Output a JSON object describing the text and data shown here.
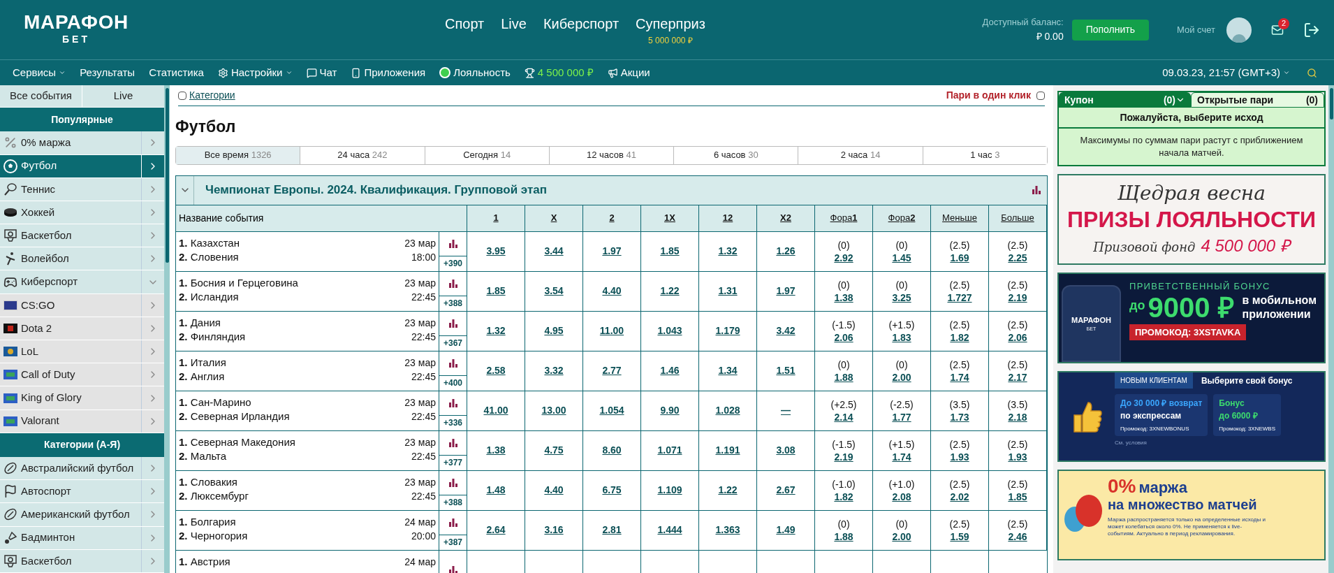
{
  "header": {
    "logo_top": "МАРАФОН",
    "logo_bottom": "БЕТ",
    "main_nav": [
      {
        "label": "Спорт"
      },
      {
        "label": "Live"
      },
      {
        "label": "Киберспорт"
      },
      {
        "label": "Суперприз",
        "sub": "5 000 000 ₽"
      }
    ],
    "balance_label": "Доступный баланс:",
    "balance": "₽ 0.00",
    "deposit_button": "Пополнить",
    "account": "Мой счет",
    "mail_badge": "2"
  },
  "nav": {
    "items": [
      {
        "label": "Сервисы",
        "kind": "menu"
      },
      {
        "label": "Результаты",
        "kind": "link"
      },
      {
        "label": "Статистика",
        "kind": "link"
      },
      {
        "label": "Настройки",
        "kind": "settings"
      },
      {
        "label": "Чат",
        "kind": "chat"
      },
      {
        "label": "Приложения",
        "kind": "app"
      },
      {
        "label": "Лояльность",
        "kind": "loyalty"
      },
      {
        "label": "4 500 000 ₽",
        "kind": "prize"
      },
      {
        "label": "Акции",
        "kind": "promo"
      }
    ],
    "datetime": "09.03.23, 21:57 (GMT+3)"
  },
  "sidebar": {
    "tabs": [
      {
        "label": "Все события"
      },
      {
        "label": "Live"
      }
    ],
    "sections": [
      {
        "title": "Популярные",
        "items": [
          {
            "label": "0% маржа",
            "kind": "margin",
            "selected": false,
            "expanded": false
          },
          {
            "label": "Футбол",
            "kind": "football",
            "selected": true,
            "expanded": false
          },
          {
            "label": "Теннис",
            "kind": "tennis",
            "selected": false,
            "expanded": false
          },
          {
            "label": "Хоккей",
            "kind": "hockey",
            "selected": false,
            "expanded": false
          },
          {
            "label": "Баскетбол",
            "kind": "basketball",
            "selected": false,
            "expanded": false
          },
          {
            "label": "Волейбол",
            "kind": "volleyball",
            "selected": false,
            "expanded": false
          },
          {
            "label": "Киберспорт",
            "kind": "esports",
            "selected": false,
            "expanded": true,
            "children": [
              {
                "label": "CS:GO",
                "kind": "csgo",
                "selected": false
              },
              {
                "label": "Dota 2",
                "kind": "dota",
                "selected": false
              },
              {
                "label": "LoL",
                "kind": "lol",
                "selected": false
              },
              {
                "label": "Call of Duty",
                "kind": "map",
                "selected": false
              },
              {
                "label": "King of Glory",
                "kind": "map",
                "selected": false
              },
              {
                "label": "Valorant",
                "kind": "map",
                "selected": false
              }
            ]
          }
        ]
      },
      {
        "title": "Категории (А-Я)",
        "items": [
          {
            "label": "Австралийский футбол",
            "kind": "oval",
            "selected": false,
            "expanded": false
          },
          {
            "label": "Автоспорт",
            "kind": "motor",
            "selected": false,
            "expanded": false
          },
          {
            "label": "Американский футбол",
            "kind": "oval",
            "selected": false,
            "expanded": false
          },
          {
            "label": "Бадминтон",
            "kind": "badminton",
            "selected": false,
            "expanded": false
          },
          {
            "label": "Баскетбол",
            "kind": "basketball",
            "selected": false,
            "expanded": false
          }
        ]
      }
    ]
  },
  "main": {
    "categories_label": "Категории",
    "categories_checked": false,
    "one_click_label": "Пари в один клик",
    "one_click_checked": false,
    "title": "Футбол",
    "time_filters": [
      {
        "label": "Все время",
        "count": "1326",
        "selected": true
      },
      {
        "label": "24 часа",
        "count": "242",
        "selected": false
      },
      {
        "label": "Сегодня",
        "count": "14",
        "selected": false
      },
      {
        "label": "12 часов",
        "count": "41",
        "selected": false
      },
      {
        "label": "6 часов",
        "count": "30",
        "selected": false
      },
      {
        "label": "2 часа",
        "count": "14",
        "selected": false
      },
      {
        "label": "1 час",
        "count": "3",
        "selected": false
      }
    ],
    "league": {
      "title": "Чемпионат Европы. 2024. Квалификация. Групповой этап",
      "expanded": true,
      "event_column": "Название события",
      "columns": [
        "1",
        "X",
        "2",
        "1X",
        "12",
        "X2",
        "Фора**1**",
        "Фора**2**",
        "Меньше",
        "Больше"
      ],
      "events": [
        {
          "team1": "**1.** Казахстан",
          "team2": "**2.** Словения",
          "date": "23 мар",
          "time": "18:00",
          "more": "+390",
          "odds": [
            "3.95",
            "3.44",
            "1.97",
            "1.85",
            "1.32",
            "1.26"
          ],
          "lines": [
            {
              "line": "(0)",
              "odd": "2.92"
            },
            {
              "line": "(0)",
              "odd": "1.45"
            },
            {
              "line": "(2.5)",
              "odd": "1.69"
            },
            {
              "line": "(2.5)",
              "odd": "2.25"
            }
          ]
        },
        {
          "team1": "**1.** Босния и Герцеговина",
          "team2": "**2.** Исландия",
          "date": "23 мар",
          "time": "22:45",
          "more": "+388",
          "odds": [
            "1.85",
            "3.54",
            "4.40",
            "1.22",
            "1.31",
            "1.97"
          ],
          "lines": [
            {
              "line": "(0)",
              "odd": "1.38"
            },
            {
              "line": "(0)",
              "odd": "3.25"
            },
            {
              "line": "(2.5)",
              "odd": "1.727"
            },
            {
              "line": "(2.5)",
              "odd": "2.19"
            }
          ]
        },
        {
          "team1": "**1.** Дания",
          "team2": "**2.** Финляндия",
          "date": "23 мар",
          "time": "22:45",
          "more": "+367",
          "odds": [
            "1.32",
            "4.95",
            "11.00",
            "1.043",
            "1.179",
            "3.42"
          ],
          "lines": [
            {
              "line": "(-1.5)",
              "odd": "2.06"
            },
            {
              "line": "(+1.5)",
              "odd": "1.83"
            },
            {
              "line": "(2.5)",
              "odd": "1.82"
            },
            {
              "line": "(2.5)",
              "odd": "2.06"
            }
          ]
        },
        {
          "team1": "**1.** Италия",
          "team2": "**2.** Англия",
          "date": "23 мар",
          "time": "22:45",
          "more": "+400",
          "odds": [
            "2.58",
            "3.32",
            "2.77",
            "1.46",
            "1.34",
            "1.51"
          ],
          "lines": [
            {
              "line": "(0)",
              "odd": "1.88"
            },
            {
              "line": "(0)",
              "odd": "2.00"
            },
            {
              "line": "(2.5)",
              "odd": "1.74"
            },
            {
              "line": "(2.5)",
              "odd": "2.17"
            }
          ]
        },
        {
          "team1": "**1.** Сан-Марино",
          "team2": "**2.** Северная Ирландия",
          "date": "23 мар",
          "time": "22:45",
          "more": "+336",
          "odds": [
            "41.00",
            "13.00",
            "1.054",
            "9.90",
            "1.028",
            "—"
          ],
          "lines": [
            {
              "line": "(+2.5)",
              "odd": "2.14"
            },
            {
              "line": "(-2.5)",
              "odd": "1.77"
            },
            {
              "line": "(3.5)",
              "odd": "1.73"
            },
            {
              "line": "(3.5)",
              "odd": "2.18"
            }
          ]
        },
        {
          "team1": "**1.** Северная Македония",
          "team2": "**2.** Мальта",
          "date": "23 мар",
          "time": "22:45",
          "more": "+377",
          "odds": [
            "1.38",
            "4.75",
            "8.60",
            "1.071",
            "1.191",
            "3.08"
          ],
          "lines": [
            {
              "line": "(-1.5)",
              "odd": "2.19"
            },
            {
              "line": "(+1.5)",
              "odd": "1.74"
            },
            {
              "line": "(2.5)",
              "odd": "1.93"
            },
            {
              "line": "(2.5)",
              "odd": "1.93"
            }
          ]
        },
        {
          "team1": "**1.** Словакия",
          "team2": "**2.** Люксембург",
          "date": "23 мар",
          "time": "22:45",
          "more": "+388",
          "odds": [
            "1.48",
            "4.40",
            "6.75",
            "1.109",
            "1.22",
            "2.67"
          ],
          "lines": [
            {
              "line": "(-1.0)",
              "odd": "1.82"
            },
            {
              "line": "(+1.0)",
              "odd": "2.08"
            },
            {
              "line": "(2.5)",
              "odd": "2.02"
            },
            {
              "line": "(2.5)",
              "odd": "1.85"
            }
          ]
        },
        {
          "team1": "**1.** Болгария",
          "team2": "**2.** Черногория",
          "date": "24 мар",
          "time": "20:00",
          "more": "+387",
          "odds": [
            "2.64",
            "3.16",
            "2.81",
            "1.444",
            "1.363",
            "1.49"
          ],
          "lines": [
            {
              "line": "(0)",
              "odd": "1.88"
            },
            {
              "line": "(0)",
              "odd": "2.00"
            },
            {
              "line": "(2.5)",
              "odd": "1.59"
            },
            {
              "line": "(2.5)",
              "odd": "2.46"
            }
          ]
        },
        {
          "team1": "**1.** Австрия",
          "date": "24 мар"
        }
      ]
    }
  },
  "coupon": {
    "tabs": [
      {
        "label": "Купон",
        "count": "(0)",
        "selected": true
      },
      {
        "label": "Открытые пари",
        "count": "(0)",
        "selected": false
      }
    ],
    "prompt": "Пожалуйста, выберите исход",
    "note": "Максимумы по суммам пари растут с приближением начала матчей."
  },
  "banners": [
    {
      "kind": "loyalty",
      "script": "Щедрая весна",
      "headline": "ПРИЗЫ ЛОЯЛЬНОСТИ",
      "fund_label": "Призовой фонд",
      "fund": "4 500 000 ₽"
    },
    {
      "kind": "app",
      "logo_top": "МАРАФОН",
      "logo_bottom": "БЕТ",
      "overline": "ПРИВЕТСТВЕННЫЙ БОНУС",
      "prefix": "до",
      "amount": "9000 ₽",
      "line1": "в мобильном",
      "line2": "приложении",
      "promo": "ПРОМОКОД: 3XSTAVKA"
    },
    {
      "kind": "choose",
      "tag": "НОВЫМ КЛИЕНТАМ",
      "heading": "Выберите свой бонус",
      "offer1_a": "До 30 000 ₽ возврат",
      "offer1_b": "по экспрессам",
      "code1": "Промокод: 3XNEWBONUS",
      "offer2_a": "Бонус",
      "offer2_b": "до 6000 ₽",
      "code2": "Промокод: 3XNEWBS",
      "terms": "См. условия"
    },
    {
      "kind": "margin",
      "zero": "0%",
      "word": "маржа",
      "line2": "на множество матчей",
      "fine_print": "Маржа распространяется только на определенные исходы и может колебаться около 0%. Не применяется к live-событиям. Актуально в период рекламирования."
    }
  ]
}
